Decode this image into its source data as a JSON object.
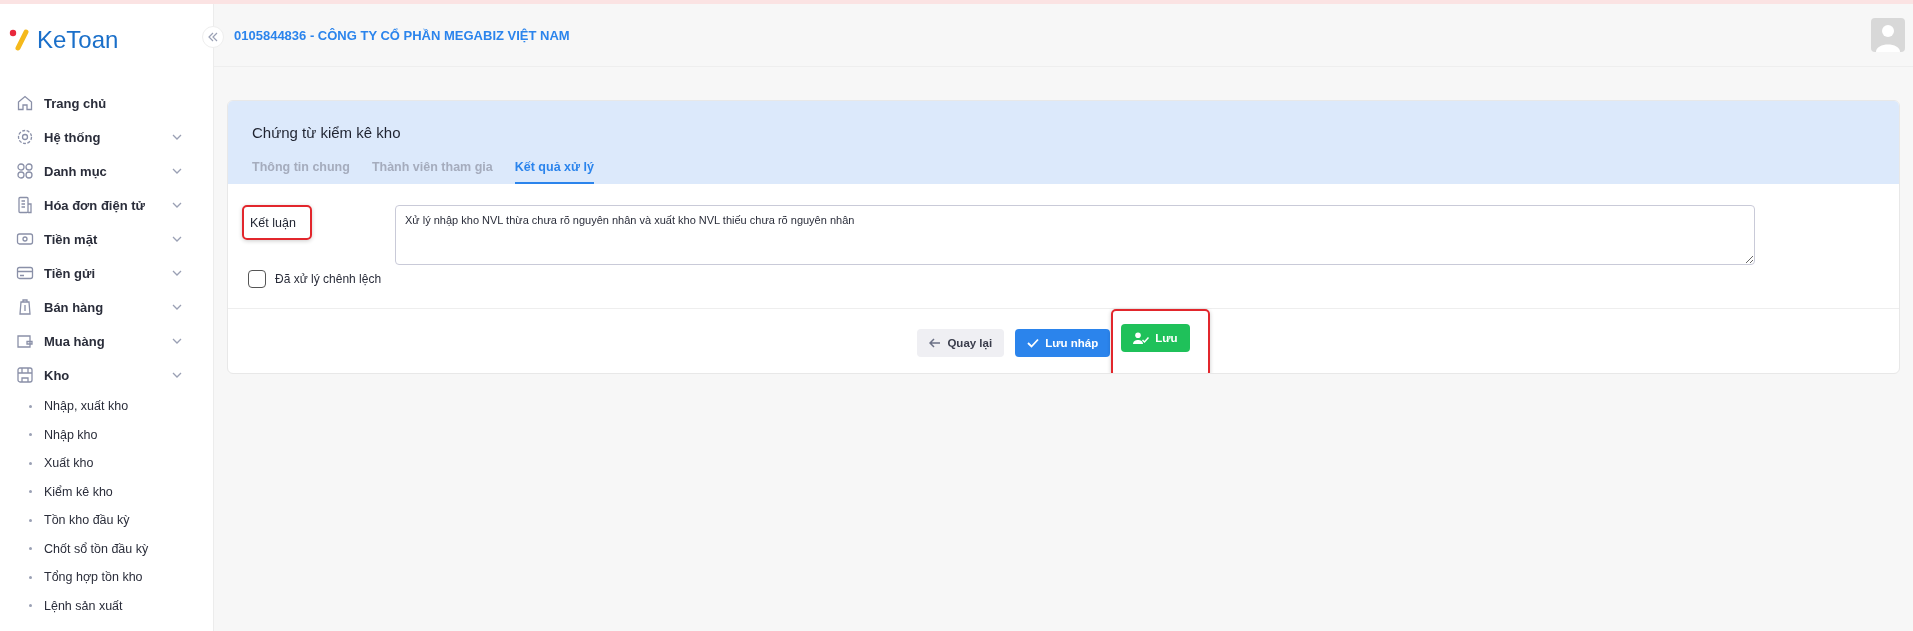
{
  "logo": {
    "text": "KeToan"
  },
  "sidebar": {
    "items": [
      {
        "label": "Trang chủ",
        "kind": "link"
      },
      {
        "label": "Hệ thống",
        "kind": "group"
      },
      {
        "label": "Danh mục",
        "kind": "group"
      },
      {
        "label": "Hóa đơn điện tử",
        "kind": "group"
      },
      {
        "label": "Tiền mặt",
        "kind": "group"
      },
      {
        "label": "Tiền gửi",
        "kind": "group"
      },
      {
        "label": "Bán hàng",
        "kind": "group"
      },
      {
        "label": "Mua hàng",
        "kind": "group"
      },
      {
        "label": "Kho",
        "kind": "group",
        "children": [
          {
            "label": "Nhập, xuất kho"
          },
          {
            "label": "Nhập kho"
          },
          {
            "label": "Xuất kho"
          },
          {
            "label": "Kiểm kê kho"
          },
          {
            "label": "Tồn kho đầu kỳ"
          },
          {
            "label": "Chốt sổ tồn đầu kỳ"
          },
          {
            "label": "Tổng hợp tồn kho"
          },
          {
            "label": "Lệnh sản xuất"
          }
        ]
      }
    ]
  },
  "header": {
    "company": "0105844836 - CÔNG TY CỔ PHẦN MEGABIZ VIỆT NAM"
  },
  "card": {
    "title": "Chứng từ kiểm kê kho",
    "tabs": [
      {
        "label": "Thông tin chung",
        "selected": false
      },
      {
        "label": "Thành viên tham gia",
        "selected": false
      },
      {
        "label": "Kết quả xử lý",
        "selected": true
      }
    ],
    "conclusion": {
      "label": "Kết luận",
      "highlighted": true,
      "value": "Xử lý nhập kho NVL thừa chưa rõ nguyên nhân và xuất kho NVL thiếu chưa rõ nguyên nhân"
    },
    "resolved": {
      "label": "Đã xử lý chênh lệch",
      "checked": false
    },
    "buttons": [
      {
        "kind": "back",
        "label": "Quay lại",
        "highlighted": false
      },
      {
        "kind": "draft",
        "label": "Lưu nháp",
        "highlighted": false
      },
      {
        "kind": "save",
        "label": "Lưu",
        "highlighted": true
      }
    ]
  }
}
